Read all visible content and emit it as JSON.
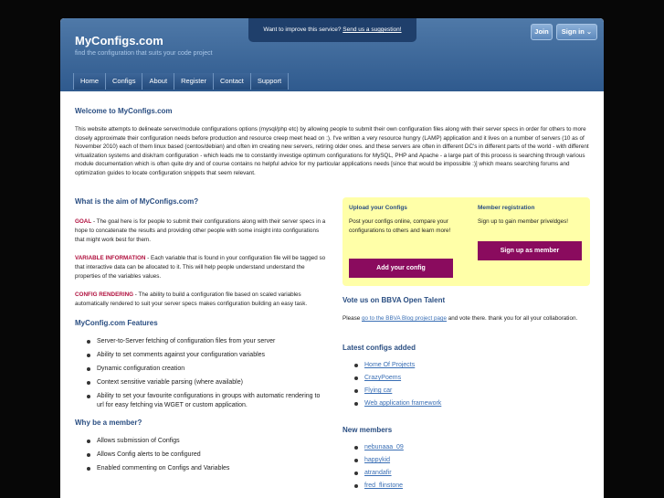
{
  "header": {
    "title": "MyConfigs.com",
    "tagline": "find the configuration that suits your code project",
    "suggest_text": "Want to improve this service?",
    "suggest_link": "Send us a suggestion!",
    "join_label": "Join",
    "signin_label": "Sign in",
    "signin_arrow": "⌄"
  },
  "nav": {
    "items": [
      "Home",
      "Configs",
      "About",
      "Register",
      "Contact",
      "Support"
    ]
  },
  "welcome": {
    "title": "Welcome to MyConfigs.com",
    "text": "This website attempts to delineate server/module configurations options (mysql/php etc) by allowing people to submit their own configuration files along with their server specs in order for others to more closely approximate their configuration needs before production and resource creep meet head on :). I've written a very resource hungry (LAMP) application and it lives on a number of servers (10 as of November 2010) each of them linux based (centos/debian) and often im creating new servers, retiring older ones. and these servers are often in different DC's in different parts of the world - with different virtualization systems and disk/ram configuration - which leads me to constantly investige optimum configurations for MySQL, PHP and Apache - a large part of this process is searching through various module documentation which is often quite dry and of course contains no helpful advice for my particular applications needs [since that would be impossible :)] which means searching forums and optimization guides to locate configuration snippets that seem relevant."
  },
  "aim": {
    "title": "What is the aim of MyConfigs.com?",
    "items": [
      {
        "term": "GOAL",
        "text": " - The goal here is for people to submit their configurations along with their server specs in a hope to concatenate the results and providing other people with some insight into configurations that might work best for them."
      },
      {
        "term": "VARIABLE INFORMATION",
        "text": " - Each variable that is found in your configuration file will be tagged so that interactive data can be allocated to it. This will help people understand understand the properties of the variables values."
      },
      {
        "term": "CONFIG RENDERING",
        "text": " - The ability to build a configuration file based on scaled variables automatically rendered to suit your server specs makes configuration building an easy task."
      }
    ]
  },
  "features": {
    "title": "MyConfig.com Features",
    "items": [
      "Server-to-Server fetching of configuration files from your server",
      "Ability to set comments against your configuration variables",
      "Dynamic configuration creation",
      "Context sensitive variable parsing (where available)",
      "Ability to set your favourite configurations in groups with automatic rendering to url for easy fetching via WGET or custom application."
    ]
  },
  "member": {
    "title": "Why be a member?",
    "items": [
      "Allows submission of Configs",
      "Allows Config alerts to be configured",
      "Enabled commenting on Configs and Variables"
    ]
  },
  "upload": {
    "title": "Upload your Configs",
    "text": "Post your configs online, compare your configurations to others and learn more!",
    "button": "Add your config"
  },
  "registration": {
    "title": "Member registration",
    "text": "Sign up to gain member priveldges!",
    "button": "Sign up as member"
  },
  "vote": {
    "title": "Vote us on BBVA Open Talent",
    "text_before": "Please ",
    "link": "go to the BBVA Blog project page",
    "text_after": " and vote there. thank you for all your collaboration."
  },
  "latest": {
    "title": "Latest configs added",
    "items": [
      "Home Of Projects",
      "CrazyPoems",
      "Flying car",
      "Web application framework"
    ]
  },
  "new_members": {
    "title": "New members",
    "items": [
      "nebunaaa_09",
      "happykid",
      "atrandafir",
      "fred_flinstone"
    ]
  }
}
